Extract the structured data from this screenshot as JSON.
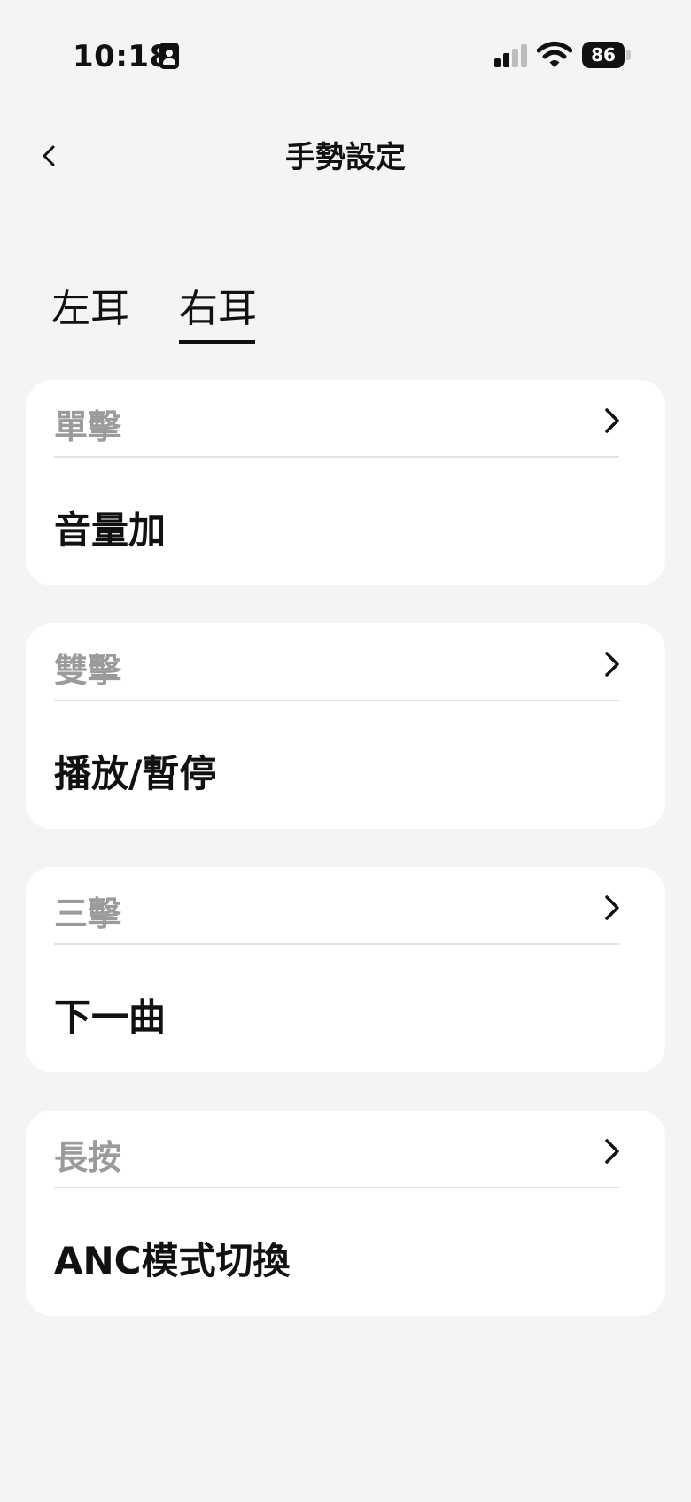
{
  "status_bar": {
    "time": "10:18",
    "battery": "86"
  },
  "header": {
    "title": "手勢設定"
  },
  "tabs": [
    {
      "label": "左耳",
      "selected": false
    },
    {
      "label": "右耳",
      "selected": true
    }
  ],
  "gestures": [
    {
      "label": "單擊",
      "value": "音量加"
    },
    {
      "label": "雙擊",
      "value": "播放/暫停"
    },
    {
      "label": "三擊",
      "value": "下一曲"
    },
    {
      "label": "長按",
      "value": "ANC模式切換"
    }
  ],
  "colors": {
    "background": "#f4f4f4",
    "card": "#ffffff",
    "label_gray": "#9b9b9b",
    "text": "#111111"
  },
  "icons": {
    "back": "chevron-left-icon",
    "card_arrow": "chevron-right-icon"
  }
}
